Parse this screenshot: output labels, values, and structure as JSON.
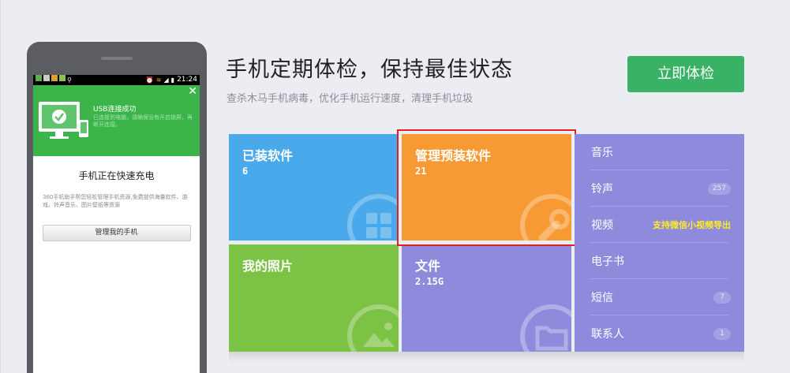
{
  "phone": {
    "time": "21:24",
    "banner_title": "USB连接成功",
    "banner_desc": "已连接到电脑，请确保没有开启锁屏，再断开连接。",
    "charging_title": "手机正在快速充电",
    "description": "360手机助手帮您轻松管理手机资源,免费提供海量软件、游戏、铃声音乐、图片壁纸等资源",
    "manage_button": "管理我的手机"
  },
  "header": {
    "title": "手机定期体检，保持最佳状态",
    "subtitle": "查杀木马手机病毒，优化手机运行速度，清理手机垃圾",
    "check_button": "立即体检"
  },
  "tiles": {
    "installed": {
      "label": "已装软件",
      "value": "6"
    },
    "preinstalled": {
      "label": "管理预装软件",
      "value": "21"
    },
    "photos": {
      "label": "我的照片"
    },
    "files": {
      "label": "文件",
      "value": "2.15G"
    }
  },
  "side": [
    {
      "label": "音乐"
    },
    {
      "label": "铃声",
      "badge": "257"
    },
    {
      "label": "视频",
      "note": "支持微信小视频导出"
    },
    {
      "label": "电子书"
    },
    {
      "label": "短信",
      "badge": "7"
    },
    {
      "label": "联系人",
      "badge": "1"
    }
  ],
  "colors": {
    "installed": "#49a9eb",
    "preinstalled": "#f79a33",
    "photos": "#7cc244",
    "files": "#8e8bdd",
    "check_button": "#3ab266",
    "highlight": "#e02020"
  }
}
